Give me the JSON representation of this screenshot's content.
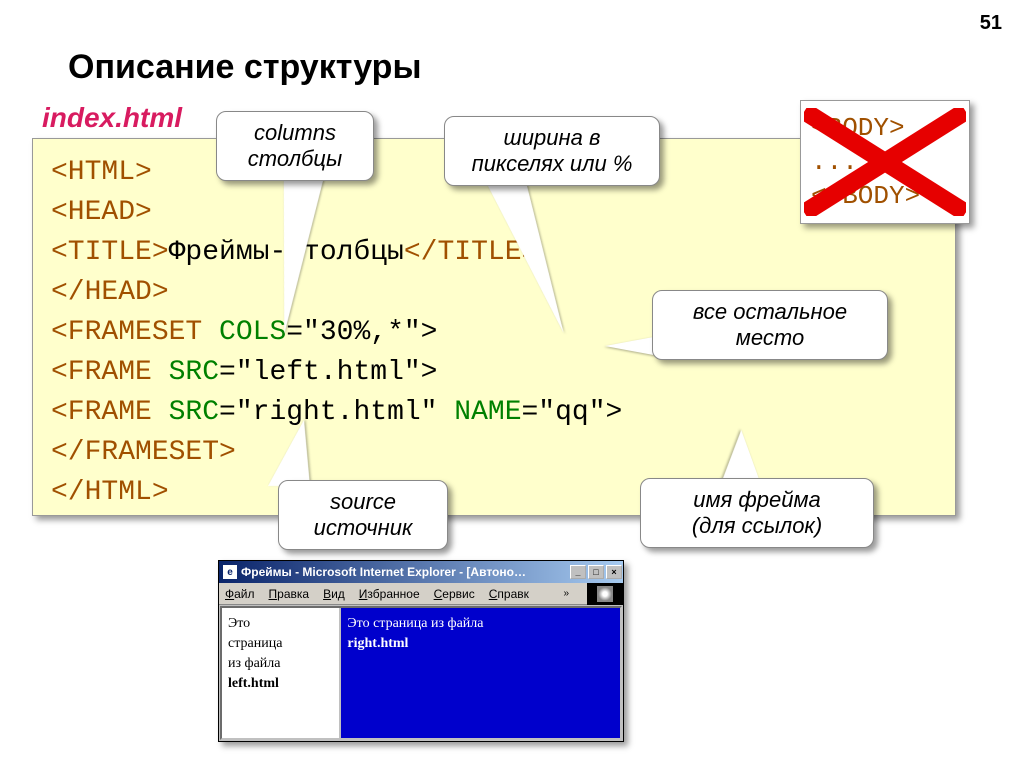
{
  "slide_number": "51",
  "title": "Описание структуры",
  "subtitle": "index.html",
  "code": {
    "l1": "<HTML>",
    "l2": "<HEAD>",
    "l3a": "   <TITLE>",
    "l3b": "Фреймы-столбцы",
    "l3c": "</TITLE>",
    "l4": "</HEAD>",
    "l5a": "<FRAMESET",
    "l5b": " COLS",
    "l5c": "=\"30%,*\">",
    "l6a": "   <FRAME",
    "l6b": " SRC",
    "l6c": "=\"left.html\">",
    "l7a": "   <FRAME",
    "l7b": " SRC",
    "l7c": "=\"right.html\"",
    "l7d": " NAME",
    "l7e": "=\"qq\">",
    "l8": "</FRAMESET>",
    "l9": "</HTML>"
  },
  "bodybox": {
    "l1": "<BODY>",
    "l2": "...",
    "l3": "</BODY>"
  },
  "callouts": {
    "c1_line1": "columns",
    "c1_line2": "столбцы",
    "c2_line1": "ширина в",
    "c2_line2": "пикселях или %",
    "c3_line1": "все остальное",
    "c3_line2": "место",
    "c4_line1": "source",
    "c4_line2": "источник",
    "c5_line1": "имя фрейма",
    "c5_line2": "(для ссылок)"
  },
  "browser": {
    "title": "Фреймы - Microsoft Internet Explorer - [Автоно…",
    "menu": {
      "file": "Файл",
      "edit": "Правка",
      "view": "Вид",
      "favorites": "Избранное",
      "tools": "Сервис",
      "help": "Справк"
    },
    "left_frame": {
      "line1": "Это",
      "line2": "страница",
      "line3": "из файла",
      "line4": "left.html"
    },
    "right_frame": {
      "line1": "Это страница из файла",
      "line2": "right.html"
    }
  }
}
